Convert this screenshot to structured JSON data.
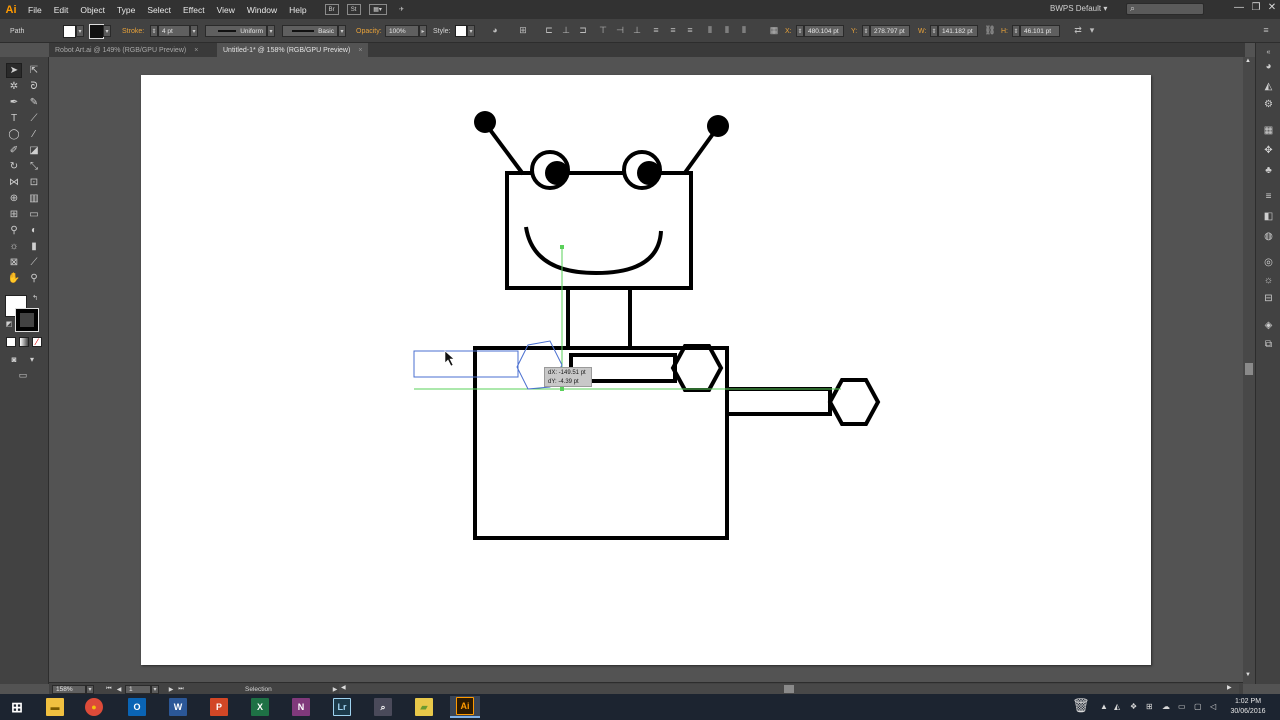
{
  "app": {
    "logo": "Ai",
    "menu": [
      "File",
      "Edit",
      "Object",
      "Type",
      "Select",
      "Effect",
      "View",
      "Window",
      "Help"
    ],
    "bridge_buttons": [
      "Br",
      "St"
    ],
    "workspace": "BWPS Default",
    "search_placeholder": ""
  },
  "control_bar": {
    "selection_type": "Path",
    "stroke_label": "Stroke:",
    "stroke_weight": "4 pt",
    "profile": "Uniform",
    "brush": "Basic",
    "opacity_label": "Opacity:",
    "opacity": "100%",
    "style_label": "Style:",
    "x_label": "X:",
    "x_value": "480.104 pt",
    "y_label": "Y:",
    "y_value": "278.797 pt",
    "w_label": "W:",
    "w_value": "141.182 pt",
    "h_label": "H:",
    "h_value": "46.101 pt"
  },
  "tabs": [
    {
      "label": "Robot Art.ai @ 149% (RGB/GPU Preview)",
      "close": "×"
    },
    {
      "label": "Untitled-1* @ 158% (RGB/GPU Preview)",
      "close": "×"
    }
  ],
  "tooltip": {
    "dx": "dX: -149.51 pt",
    "dy": "dY: -4.39 pt"
  },
  "status_bar": {
    "zoom": "158%",
    "artboard": "1",
    "tool_name": "Selection"
  },
  "taskbar": {
    "apps": [
      {
        "name": "start",
        "glyph": "⊞",
        "color": "#1c2430"
      },
      {
        "name": "file-explorer",
        "glyph": "▬",
        "color": "#f0c040"
      },
      {
        "name": "chrome",
        "glyph": "●",
        "color": "#dd4b39"
      },
      {
        "name": "outlook",
        "glyph": "O",
        "color": "#0a64b4"
      },
      {
        "name": "word",
        "glyph": "W",
        "color": "#2b5797"
      },
      {
        "name": "powerpoint",
        "glyph": "P",
        "color": "#d24726"
      },
      {
        "name": "excel",
        "glyph": "X",
        "color": "#1e7145"
      },
      {
        "name": "onenote",
        "glyph": "N",
        "color": "#80397b"
      },
      {
        "name": "lightroom",
        "glyph": "Lr",
        "color": "#1c3a4a"
      },
      {
        "name": "magnifier",
        "glyph": "⌕",
        "color": "#4a4a5a"
      },
      {
        "name": "folder",
        "glyph": "▰",
        "color": "#e8c84a"
      },
      {
        "name": "illustrator",
        "glyph": "Ai",
        "color": "#2d1a00"
      }
    ],
    "time": "1:02 PM",
    "date": "30/06/2016"
  },
  "colors": {
    "accent": "#ff9a00",
    "guide": "#5ad05a",
    "selection": "#4a6fd0"
  }
}
